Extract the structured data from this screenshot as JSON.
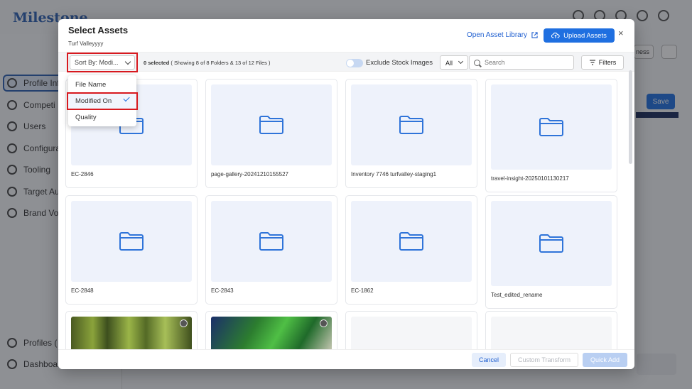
{
  "background": {
    "logo": "Milestone",
    "nav_items": [
      "Profile Inf",
      "Competi",
      "Users",
      "Configura",
      "Tooling",
      "Target Au",
      "Brand Voi",
      "Profiles (",
      "Dashboa"
    ],
    "save_label": "Save",
    "mini_label": "ness"
  },
  "modal": {
    "title": "Select Assets",
    "subtitle": "Turf Valleyyyy",
    "open_library": "Open Asset Library",
    "upload": "Upload Assets",
    "close": "×"
  },
  "toolbar": {
    "sort_label": "Sort By: Modi...",
    "selected_count": "0 selected",
    "showing": "( Showing 8 of 8 Folders & 13 of 12 Files )",
    "exclude_stock": "Exclude Stock Images",
    "type_filter": "All",
    "search_placeholder": "Search",
    "filters": "Filters"
  },
  "sort_dropdown": {
    "options": [
      "File Name",
      "Modified On",
      "Quality"
    ],
    "selected": "Modified On"
  },
  "folders": [
    {
      "name": "EC-2846"
    },
    {
      "name": "page-gallery-20241210155527"
    },
    {
      "name": "Inventory 7746 turfvalley-staging1"
    },
    {
      "name": "travel-insight-20250101130217"
    },
    {
      "name": "EC-2848"
    },
    {
      "name": "EC-2843"
    },
    {
      "name": "EC-1862"
    },
    {
      "name": "Test_edited_rename"
    }
  ],
  "footer": {
    "cancel": "Cancel",
    "custom_transform": "Custom Transform",
    "quick_add": "Quick Add"
  },
  "colors": {
    "accent": "#1f6fe0",
    "highlight": "#d8191f",
    "folder_icon": "#2f74d9"
  }
}
